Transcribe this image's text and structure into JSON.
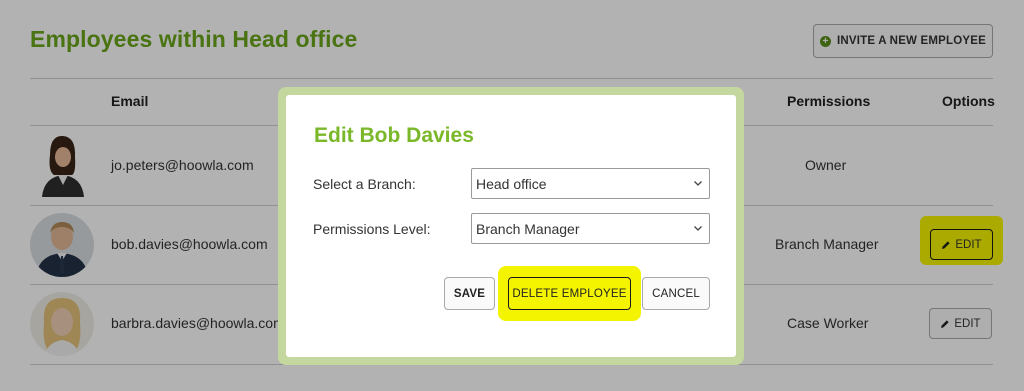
{
  "page": {
    "title": "Employees within Head office",
    "invite_label": "INVITE A NEW EMPLOYEE"
  },
  "table": {
    "headers": {
      "email": "Email",
      "permissions": "Permissions",
      "options": "Options"
    },
    "rows": [
      {
        "email": "jo.peters@hoowla.com",
        "permissions": "Owner",
        "action": ""
      },
      {
        "email": "bob.davies@hoowla.com",
        "permissions": "Branch Manager",
        "action": "EDIT"
      },
      {
        "email": "barbra.davies@hoowla.com",
        "permissions": "Case Worker",
        "action": "EDIT"
      }
    ]
  },
  "modal": {
    "title": "Edit Bob Davies",
    "branch_label": "Select a Branch:",
    "branch_value": "Head office",
    "permissions_label": "Permissions Level:",
    "permissions_value": "Branch Manager",
    "save_label": "SAVE",
    "delete_label": "DELETE EMPLOYEE",
    "cancel_label": "CANCEL"
  },
  "colors": {
    "accent_green": "#6aa51a",
    "modal_title_green": "#7ab829",
    "highlight_yellow": "#f4f400"
  },
  "icons": {
    "invite": "plus-circle-icon",
    "edit": "pencil-icon",
    "select": "chevron-down-icon"
  }
}
